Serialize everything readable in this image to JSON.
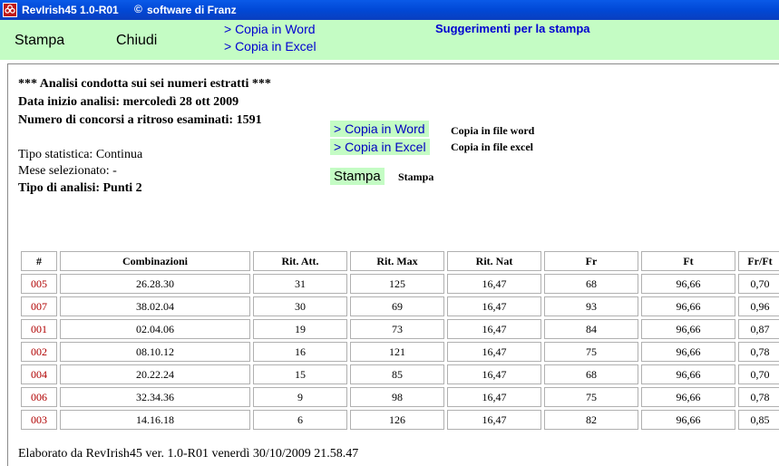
{
  "window": {
    "title": "RevIrish45 1.0-R01",
    "copyright_symbol": "©",
    "subtitle": "software di Franz",
    "title_bar_color": "#0148d6"
  },
  "menubar": {
    "stampa": "Stampa",
    "chiudi": "Chiudi",
    "copia_word": "> Copia in Word",
    "copia_excel": "> Copia in Excel",
    "suggerimenti": "Suggerimenti per la stampa",
    "background": "#c4fcc4"
  },
  "summary": {
    "line1": "*** Analisi condotta sui sei numeri estratti ***",
    "line2": "Data inizio analisi: mercoledì 28 ott 2009",
    "line3": "Numero di concorsi a ritroso esaminati: 1591",
    "tipo_statistica": "Tipo statistica: Continua",
    "mese": "Mese selezionato: -",
    "tipo_analisi": "Tipo di analisi: Punti 2"
  },
  "actions": {
    "copia_word": "> Copia in Word",
    "copia_word_desc": "Copia in file word",
    "copia_excel": "> Copia in Excel",
    "copia_excel_desc": "Copia in file excel",
    "stampa": "Stampa",
    "stampa_desc": "Stampa"
  },
  "table": {
    "headers": [
      "#",
      "Combinazioni",
      "Rit. Att.",
      "Rit. Max",
      "Rit. Nat",
      "Fr",
      "Ft",
      "Fr/Ft"
    ],
    "rows": [
      [
        "005",
        "26.28.30",
        "31",
        "125",
        "16,47",
        "68",
        "96,66",
        "0,70"
      ],
      [
        "007",
        "38.02.04",
        "30",
        "69",
        "16,47",
        "93",
        "96,66",
        "0,96"
      ],
      [
        "001",
        "02.04.06",
        "19",
        "73",
        "16,47",
        "84",
        "96,66",
        "0,87"
      ],
      [
        "002",
        "08.10.12",
        "16",
        "121",
        "16,47",
        "75",
        "96,66",
        "0,78"
      ],
      [
        "004",
        "20.22.24",
        "15",
        "85",
        "16,47",
        "68",
        "96,66",
        "0,70"
      ],
      [
        "006",
        "32.34.36",
        "9",
        "98",
        "16,47",
        "75",
        "96,66",
        "0,78"
      ],
      [
        "003",
        "14.16.18",
        "6",
        "126",
        "16,47",
        "82",
        "96,66",
        "0,85"
      ]
    ]
  },
  "footer": "Elaborato da RevIrish45 ver. 1.0-R01  venerdì 30/10/2009 21.58.47"
}
